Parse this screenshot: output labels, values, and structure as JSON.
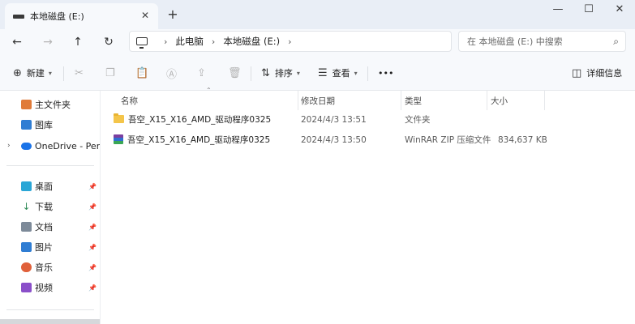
{
  "tab": {
    "title": "本地磁盘 (E:)",
    "close_glyph": "✕"
  },
  "newtab_glyph": "+",
  "window": {
    "minimize": "—",
    "maximize": "☐",
    "close": "✕"
  },
  "nav": {
    "back": "←",
    "forward": "→",
    "up": "↑",
    "refresh": "↻"
  },
  "breadcrumb": {
    "sep": "›",
    "items": [
      "此电脑",
      "本地磁盘 (E:)"
    ]
  },
  "search": {
    "placeholder": "在 本地磁盘 (E:) 中搜索",
    "icon": "search-icon"
  },
  "toolbar": {
    "new_label": "新建",
    "sort_label": "排序",
    "view_label": "查看",
    "more_label": "•••",
    "details_label": "详细信息"
  },
  "sidebar": {
    "items": [
      {
        "label": "主文件夹",
        "color": "#e07b39"
      },
      {
        "label": "图库",
        "color": "#2f7dd3"
      },
      {
        "label": "OneDrive - Personal",
        "color": "#1a73e8"
      },
      {
        "label": "桌面",
        "color": "#2aa6d6"
      },
      {
        "label": "下载",
        "color": "#2e8b57"
      },
      {
        "label": "文档",
        "color": "#7d8a99"
      },
      {
        "label": "图片",
        "color": "#2f7dd3"
      },
      {
        "label": "音乐",
        "color": "#e0603a"
      },
      {
        "label": "视频",
        "color": "#8a4fc9"
      }
    ],
    "pin_glyph": "📌"
  },
  "columns": {
    "name": "名称",
    "date": "修改日期",
    "type": "类型",
    "size": "大小"
  },
  "files": [
    {
      "name": "吾空_X15_X16_AMD_驱动程序0325",
      "date": "2024/4/3 13:51",
      "type": "文件夹",
      "size": "",
      "kind": "folder"
    },
    {
      "name": "吾空_X15_X16_AMD_驱动程序0325",
      "date": "2024/4/3 13:50",
      "type": "WinRAR ZIP 压缩文件",
      "size": "834,637 KB",
      "kind": "zip"
    }
  ]
}
